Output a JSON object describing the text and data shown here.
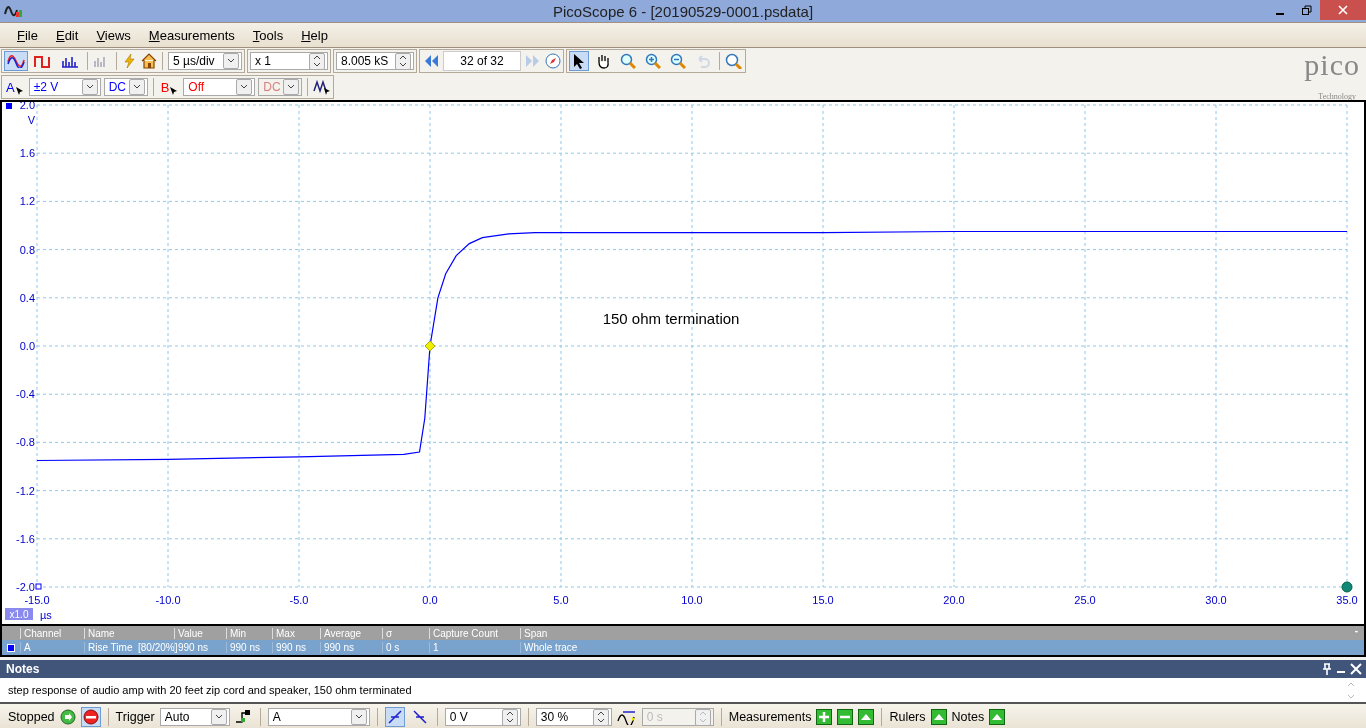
{
  "window": {
    "title": "PicoScope 6 - [20190529-0001.psdata]"
  },
  "menu": [
    {
      "label": "File"
    },
    {
      "label": "Edit"
    },
    {
      "label": "Views"
    },
    {
      "label": "Measurements"
    },
    {
      "label": "Tools"
    },
    {
      "label": "Help"
    }
  ],
  "toolbar": {
    "modes": [
      {
        "kind": "scope",
        "selected": true
      },
      {
        "kind": "persistence",
        "selected": false
      },
      {
        "kind": "spectrum",
        "selected": false
      }
    ],
    "timebase": "5 µs/div",
    "zoom": "x 1",
    "samples": "8.005 kS",
    "buffer": "32 of 32",
    "tools": [
      {
        "kind": "pointer",
        "selected": true,
        "disabled": false
      },
      {
        "kind": "hand",
        "selected": false,
        "disabled": false
      },
      {
        "kind": "zoom-area",
        "selected": false,
        "disabled": false
      },
      {
        "kind": "zoom-in",
        "selected": false,
        "disabled": false
      },
      {
        "kind": "zoom-out",
        "selected": false,
        "disabled": false
      },
      {
        "kind": "undo",
        "selected": false,
        "disabled": true
      }
    ]
  },
  "logo": {
    "name": "pico",
    "tagline": "Technology"
  },
  "channels": [
    {
      "name": "A",
      "range": "±2 V",
      "coupling": "DC",
      "enabled": true,
      "color": "#0000ff"
    },
    {
      "name": "B",
      "range": "Off",
      "coupling": "DC",
      "enabled": false,
      "color": "#ff0000"
    }
  ],
  "scope": {
    "unit_y": "V",
    "unit_x": "µs",
    "zoom_badge": "x1.0",
    "annotation": "150 ohm termination",
    "chart_data": {
      "type": "line",
      "grid": true,
      "xlim": [
        -15,
        35
      ],
      "ylim": [
        -2,
        2
      ],
      "xticks": [
        {
          "value": -15,
          "label": "-15.0"
        },
        {
          "value": -10,
          "label": "-10.0"
        },
        {
          "value": -5,
          "label": "-5.0"
        },
        {
          "value": 0,
          "label": "0.0"
        },
        {
          "value": 5,
          "label": "5.0"
        },
        {
          "value": 10,
          "label": "10.0"
        },
        {
          "value": 15,
          "label": "15.0"
        },
        {
          "value": 20,
          "label": "20.0"
        },
        {
          "value": 25,
          "label": "25.0"
        },
        {
          "value": 30,
          "label": "30.0"
        },
        {
          "value": 35,
          "label": "35.0"
        }
      ],
      "yticks": [
        {
          "value": 2,
          "label": "2.0"
        },
        {
          "value": 1.6,
          "label": "1.6"
        },
        {
          "value": 1.2,
          "label": "1.2"
        },
        {
          "value": 0.8,
          "label": "0.8"
        },
        {
          "value": 0.4,
          "label": "0.4"
        },
        {
          "value": 0,
          "label": "0.0"
        },
        {
          "value": -0.4,
          "label": "-0.4"
        },
        {
          "value": -0.8,
          "label": "-0.8"
        },
        {
          "value": -1.2,
          "label": "-1.2"
        },
        {
          "value": -1.6,
          "label": "-1.6"
        },
        {
          "value": -2,
          "label": "-2.0"
        }
      ],
      "x": [
        -15,
        -10,
        -5,
        -1,
        -0.4,
        -0.2,
        0,
        0.3,
        0.6,
        1,
        1.5,
        2,
        3,
        4,
        5,
        10,
        15,
        20,
        25,
        30,
        35
      ],
      "series": [
        {
          "color": "#0000ff",
          "values": [
            -0.95,
            -0.94,
            -0.92,
            -0.9,
            -0.88,
            -0.6,
            0,
            0.4,
            0.6,
            0.75,
            0.85,
            0.9,
            0.93,
            0.94,
            0.94,
            0.94,
            0.94,
            0.95,
            0.95,
            0.95,
            0.95
          ]
        }
      ]
    }
  },
  "measurements": {
    "columns": [
      "Channel",
      "Name",
      "Value",
      "Min",
      "Max",
      "Average",
      "σ",
      "Capture Count",
      "Span"
    ],
    "collapse": "-",
    "rows": [
      {
        "selected": true,
        "color": "#0000ff",
        "cells": [
          "A",
          "Rise Time  [80/20%]",
          "990 ns",
          "990 ns",
          "990 ns",
          "990 ns",
          "0 s",
          "1",
          "Whole trace"
        ]
      }
    ]
  },
  "notes": {
    "title": "Notes",
    "text": "step response of audio amp with 20 feet zip cord and speaker, 150 ohm terminated"
  },
  "status": {
    "state": "Stopped",
    "trigger_label": "Trigger",
    "trigger_mode": "Auto",
    "trigger_channel": "A",
    "threshold": "0 V",
    "pretrigger": "30 %",
    "delay": "0 s",
    "delay_disabled": true,
    "edges": [
      {
        "kind": "rising",
        "selected": true
      },
      {
        "kind": "falling",
        "selected": false
      }
    ],
    "measurements_label": "Measurements",
    "rulers_label": "Rulers",
    "notes_label": "Notes"
  }
}
